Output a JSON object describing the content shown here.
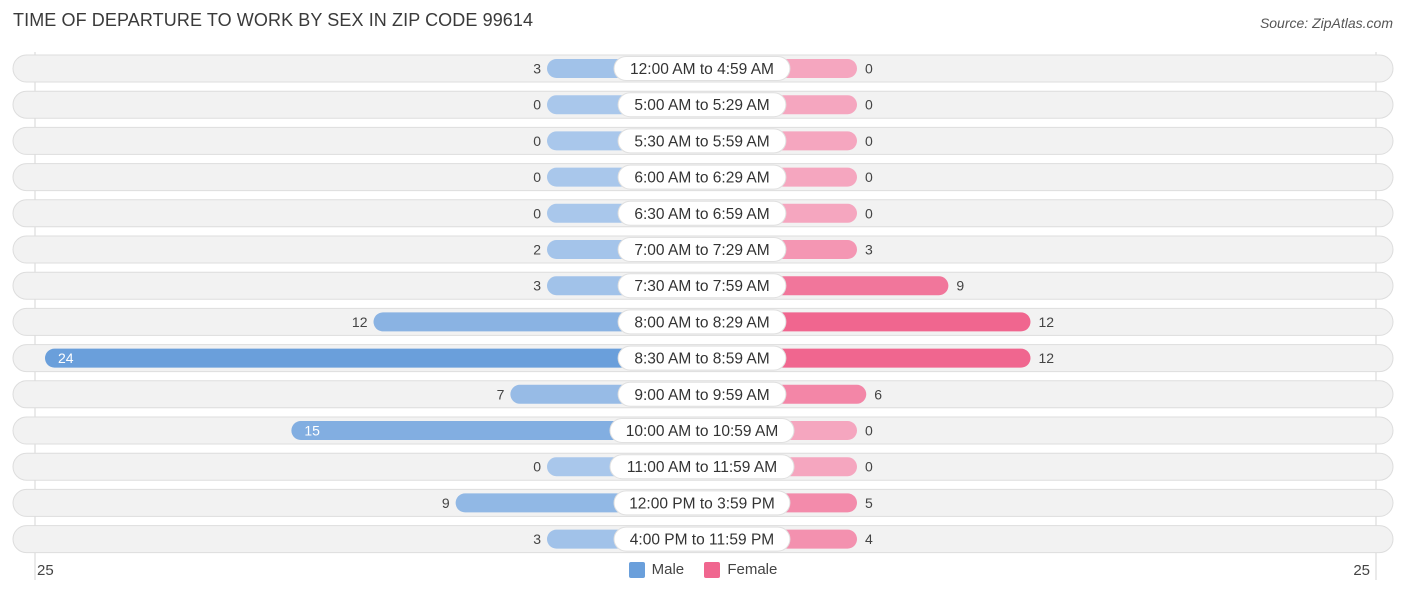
{
  "header": {
    "title": "TIME OF DEPARTURE TO WORK BY SEX IN ZIP CODE 99614",
    "source": "Source: ZipAtlas.com"
  },
  "colors": {
    "male": "#6a9fdb",
    "male_light": "#a9c7eb",
    "female": "#f0668f",
    "female_light": "#f5a6bf",
    "row_bg": "#f2f2f2",
    "row_border": "#dddddd"
  },
  "legend": {
    "male_label": "Male",
    "female_label": "Female"
  },
  "axis": {
    "left_label": "25",
    "right_label": "25"
  },
  "chart_data": {
    "type": "bar",
    "orientation": "horizontal-diverging",
    "title": "TIME OF DEPARTURE TO WORK BY SEX IN ZIP CODE 99614",
    "xlabel": "",
    "ylabel": "",
    "xlim": [
      -25,
      25
    ],
    "legend_position": "bottom-center",
    "grid": false,
    "categories": [
      "12:00 AM to 4:59 AM",
      "5:00 AM to 5:29 AM",
      "5:30 AM to 5:59 AM",
      "6:00 AM to 6:29 AM",
      "6:30 AM to 6:59 AM",
      "7:00 AM to 7:29 AM",
      "7:30 AM to 7:59 AM",
      "8:00 AM to 8:29 AM",
      "8:30 AM to 8:59 AM",
      "9:00 AM to 9:59 AM",
      "10:00 AM to 10:59 AM",
      "11:00 AM to 11:59 AM",
      "12:00 PM to 3:59 PM",
      "4:00 PM to 11:59 PM"
    ],
    "series": [
      {
        "name": "Male",
        "values": [
          3,
          0,
          0,
          0,
          0,
          2,
          3,
          12,
          24,
          7,
          15,
          0,
          9,
          3
        ]
      },
      {
        "name": "Female",
        "values": [
          0,
          0,
          0,
          0,
          0,
          3,
          9,
          12,
          12,
          6,
          0,
          0,
          5,
          4
        ]
      }
    ]
  }
}
